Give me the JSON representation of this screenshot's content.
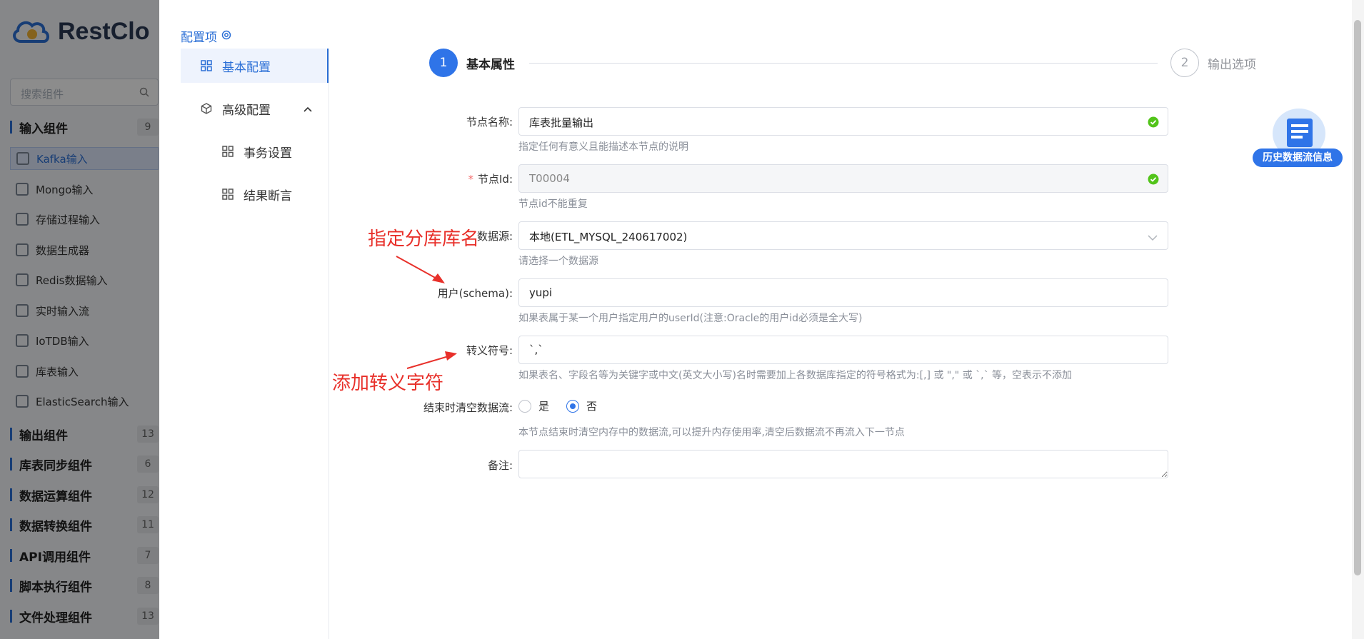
{
  "background": {
    "brand": "RestClo",
    "search_placeholder": "搜索组件",
    "groups": [
      {
        "label": "输入组件",
        "count": "9"
      },
      {
        "label": "输出组件",
        "count": "13"
      },
      {
        "label": "库表同步组件",
        "count": "6"
      },
      {
        "label": "数据运算组件",
        "count": "12"
      },
      {
        "label": "数据转换组件",
        "count": "11"
      },
      {
        "label": "API调用组件",
        "count": "7"
      },
      {
        "label": "脚本执行组件",
        "count": "8"
      },
      {
        "label": "文件处理组件",
        "count": "13"
      }
    ],
    "items": [
      {
        "label": "Kafka输入"
      },
      {
        "label": "Mongo输入"
      },
      {
        "label": "存储过程输入"
      },
      {
        "label": "数据生成器"
      },
      {
        "label": "Redis数据输入"
      },
      {
        "label": "实时输入流"
      },
      {
        "label": "IoTDB输入"
      },
      {
        "label": "库表输入"
      },
      {
        "label": "ElasticSearch输入"
      }
    ]
  },
  "drawer": {
    "config_title": "配置项",
    "nav": [
      {
        "label": "基本配置"
      },
      {
        "label": "高级配置"
      },
      {
        "label": "事务设置"
      },
      {
        "label": "结果断言"
      }
    ],
    "steps": [
      {
        "num": "1",
        "label": "基本属性"
      },
      {
        "num": "2",
        "label": "输出选项"
      }
    ],
    "form": {
      "node_name": {
        "label": "节点名称:",
        "value": "库表批量输出",
        "hint": "指定任何有意义且能描述本节点的说明"
      },
      "node_id": {
        "required": "*",
        "label": "节点Id:",
        "value": "T00004",
        "hint": "节点id不能重复"
      },
      "datasource": {
        "label": "数据源:",
        "value": "本地(ETL_MYSQL_240617002)",
        "hint": "请选择一个数据源"
      },
      "schema": {
        "label": "用户(schema):",
        "value": "yupi",
        "hint": "如果表属于某一个用户指定用户的userId(注意:Oracle的用户id必须是全大写)"
      },
      "escape": {
        "label": "转义符号:",
        "value": "`,`",
        "hint": "如果表名、字段名等为关键字或中文(英文大小写)名时需要加上各数据库指定的符号格式为:[,] 或 \",\" 或 `,` 等，空表示不添加"
      },
      "clear_stream": {
        "label": "结束时清空数据流:",
        "options": [
          "是",
          "否"
        ],
        "selected": "否",
        "hint": "本节点结束时清空内存中的数据流,可以提升内存使用率,清空后数据流不再流入下一节点"
      },
      "remark": {
        "label": "备注:",
        "value": ""
      }
    },
    "history_badge": "历史数据流信息"
  },
  "annotations": {
    "db_name": "指定分库库名",
    "escape_char": "添加转义字符"
  },
  "colors": {
    "accent": "#2f74e8",
    "annotation": "#e8302a",
    "success": "#52c41a"
  }
}
